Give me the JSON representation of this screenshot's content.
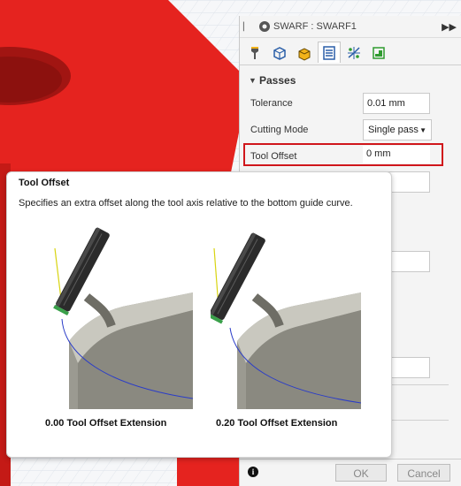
{
  "panel": {
    "title": "SWARF : SWARF1",
    "expand_glyph": "▶▶",
    "tabs": [
      "tool",
      "geometry",
      "heights",
      "passes",
      "linking",
      "shape"
    ],
    "active_tab": "passes",
    "section": {
      "caret": "▼",
      "title": "Passes"
    },
    "rows": {
      "tolerance": {
        "label": "Tolerance",
        "value": "0.01 mm"
      },
      "cutting_mode": {
        "label": "Cutting Mode",
        "value": "Single pass",
        "arrow": "▼"
      },
      "tool_offset": {
        "label": "Tool Offset",
        "value": "0 mm"
      }
    },
    "footer": {
      "info_glyph": "i",
      "ok_label": "OK",
      "cancel_label": "Cancel"
    }
  },
  "tooltip": {
    "title": "Tool Offset",
    "description": "Specifies an extra offset along the tool axis relative to the bottom guide curve.",
    "figures": [
      {
        "caption": "0.00 Tool Offset Extension"
      },
      {
        "caption": "0.20 Tool Offset Extension"
      }
    ]
  },
  "colors": {
    "model_red": "#e5231f",
    "highlight_red": "#d0161b",
    "part_gray": "#9b9a91",
    "guide_blue": "#2a3cc8"
  }
}
